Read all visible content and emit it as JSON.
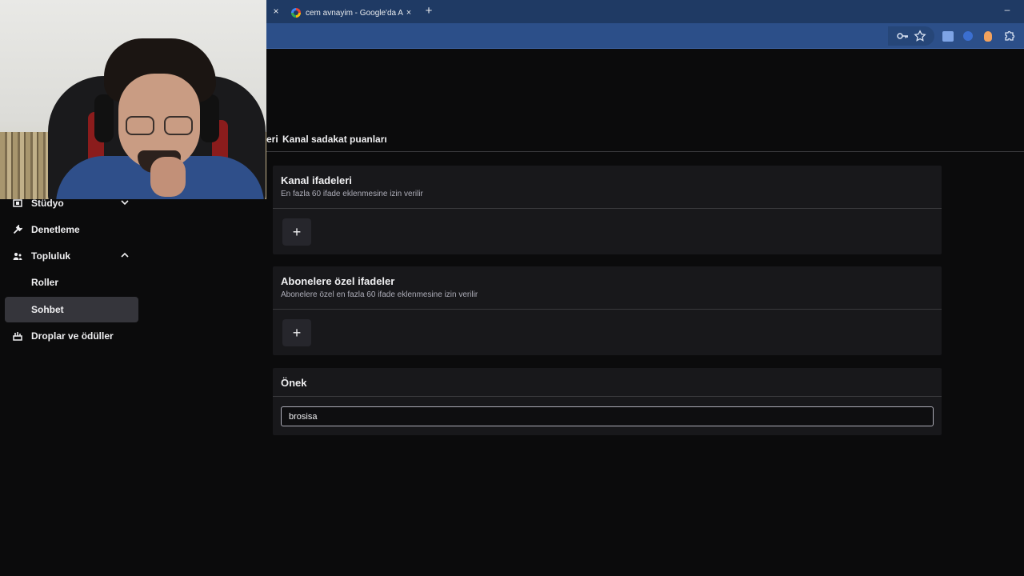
{
  "browser": {
    "prev_tab_close": "×",
    "tab_title": "cem avnayim - Google'da Ara",
    "tab_close": "×",
    "new_tab": "+",
    "minimize": "–"
  },
  "sidebar": {
    "items": [
      {
        "label": "Stüdyo",
        "icon": "studio-icon"
      },
      {
        "label": "Denetleme",
        "icon": "wrench-icon"
      },
      {
        "label": "Topluluk",
        "icon": "community-icon"
      },
      {
        "label": "Roller"
      },
      {
        "label": "Sohbet"
      },
      {
        "label": "Droplar ve ödüller",
        "icon": "drops-icon"
      }
    ]
  },
  "tabs": {
    "partial_tab": "eri",
    "loyalty_tab": "Kanal sadakat puanları"
  },
  "cards": {
    "channel_emotes": {
      "title": "Kanal ifadeleri",
      "subtitle": "En fazla 60 ifade eklenmesine izin verilir",
      "add": "+"
    },
    "sub_emotes": {
      "title": "Abonelere özel ifadeler",
      "subtitle": "Abonelere özel en fazla 60 ifade eklenmesine izin verilir",
      "add": "+"
    },
    "prefix": {
      "title": "Önek",
      "value": "brosisa"
    }
  },
  "colors": {
    "background": "#0b0b0c",
    "card": "#18181b",
    "active_nav": "#35353b",
    "browser_tabbar": "#1f3a64",
    "browser_toolbar": "#2c4f89"
  }
}
